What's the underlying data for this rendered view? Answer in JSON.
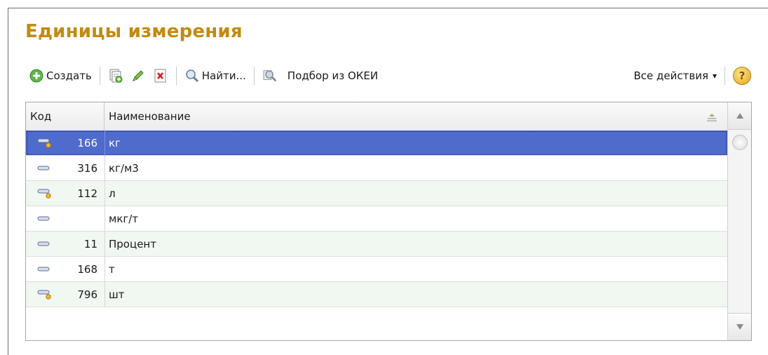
{
  "form": {
    "title": "Единицы измерения"
  },
  "toolbar": {
    "create_label": "Создать",
    "find_label": "Найти...",
    "okei_label": "Подбор из ОКЕИ",
    "all_actions_label": "Все действия",
    "all_actions_arrow": "▾",
    "help_label": "?"
  },
  "table": {
    "columns": {
      "code": "Код",
      "name": "Наименование"
    },
    "rows": [
      {
        "code": "166",
        "name": "кг",
        "icon": "unit-marked-icon",
        "selected": true
      },
      {
        "code": "316",
        "name": "кг/м3",
        "icon": "unit-icon"
      },
      {
        "code": "112",
        "name": "л",
        "icon": "unit-marked-icon"
      },
      {
        "code": "",
        "name": "мкг/т",
        "icon": "unit-icon"
      },
      {
        "code": "11",
        "name": "Процент",
        "icon": "unit-icon"
      },
      {
        "code": "168",
        "name": "т",
        "icon": "unit-icon"
      },
      {
        "code": "796",
        "name": "шт",
        "icon": "unit-marked-icon"
      }
    ]
  },
  "colors": {
    "title": "#c28a10",
    "selection": "#4f6bcc",
    "alt_row": "#f1f7f1"
  }
}
